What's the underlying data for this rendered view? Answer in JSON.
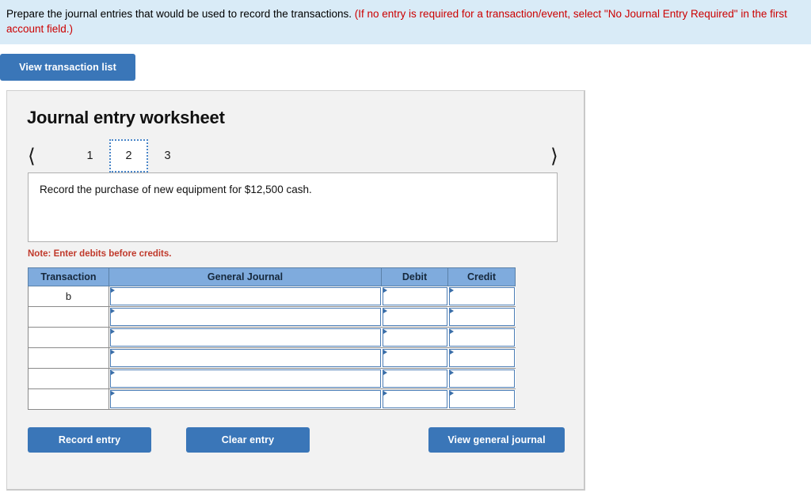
{
  "banner": {
    "main_text": "Prepare the journal entries that would be used to record the transactions.",
    "required_text": "(If no entry is required for a transaction/event, select \"No Journal Entry Required\" in the first account field.)"
  },
  "toolbar": {
    "view_transaction_list_label": "View transaction list"
  },
  "worksheet": {
    "title": "Journal entry worksheet",
    "pager": {
      "prev_icon": "chevron-left",
      "next_icon": "chevron-right",
      "tabs": [
        {
          "label": "1",
          "active": false
        },
        {
          "label": "2",
          "active": true
        },
        {
          "label": "3",
          "active": false
        }
      ]
    },
    "scenario_text": "Record the purchase of new equipment for $12,500 cash.",
    "note_text": "Note: Enter debits before credits.",
    "table": {
      "headers": [
        "Transaction",
        "General Journal",
        "Debit",
        "Credit"
      ],
      "rows": [
        {
          "transaction": "b",
          "general_journal": "",
          "debit": "",
          "credit": ""
        },
        {
          "transaction": "",
          "general_journal": "",
          "debit": "",
          "credit": ""
        },
        {
          "transaction": "",
          "general_journal": "",
          "debit": "",
          "credit": ""
        },
        {
          "transaction": "",
          "general_journal": "",
          "debit": "",
          "credit": ""
        },
        {
          "transaction": "",
          "general_journal": "",
          "debit": "",
          "credit": ""
        },
        {
          "transaction": "",
          "general_journal": "",
          "debit": "",
          "credit": ""
        }
      ]
    },
    "actions": {
      "record_entry_label": "Record entry",
      "clear_entry_label": "Clear entry",
      "view_general_journal_label": "View general journal"
    }
  },
  "colors": {
    "banner_bg": "#d9ebf7",
    "required_red": "#cc0000",
    "button_blue": "#3a76b8",
    "table_header_blue": "#7fabdd",
    "panel_bg": "#f2f2f2",
    "note_red": "#c0392b",
    "active_tab_border": "#4a86c8"
  }
}
